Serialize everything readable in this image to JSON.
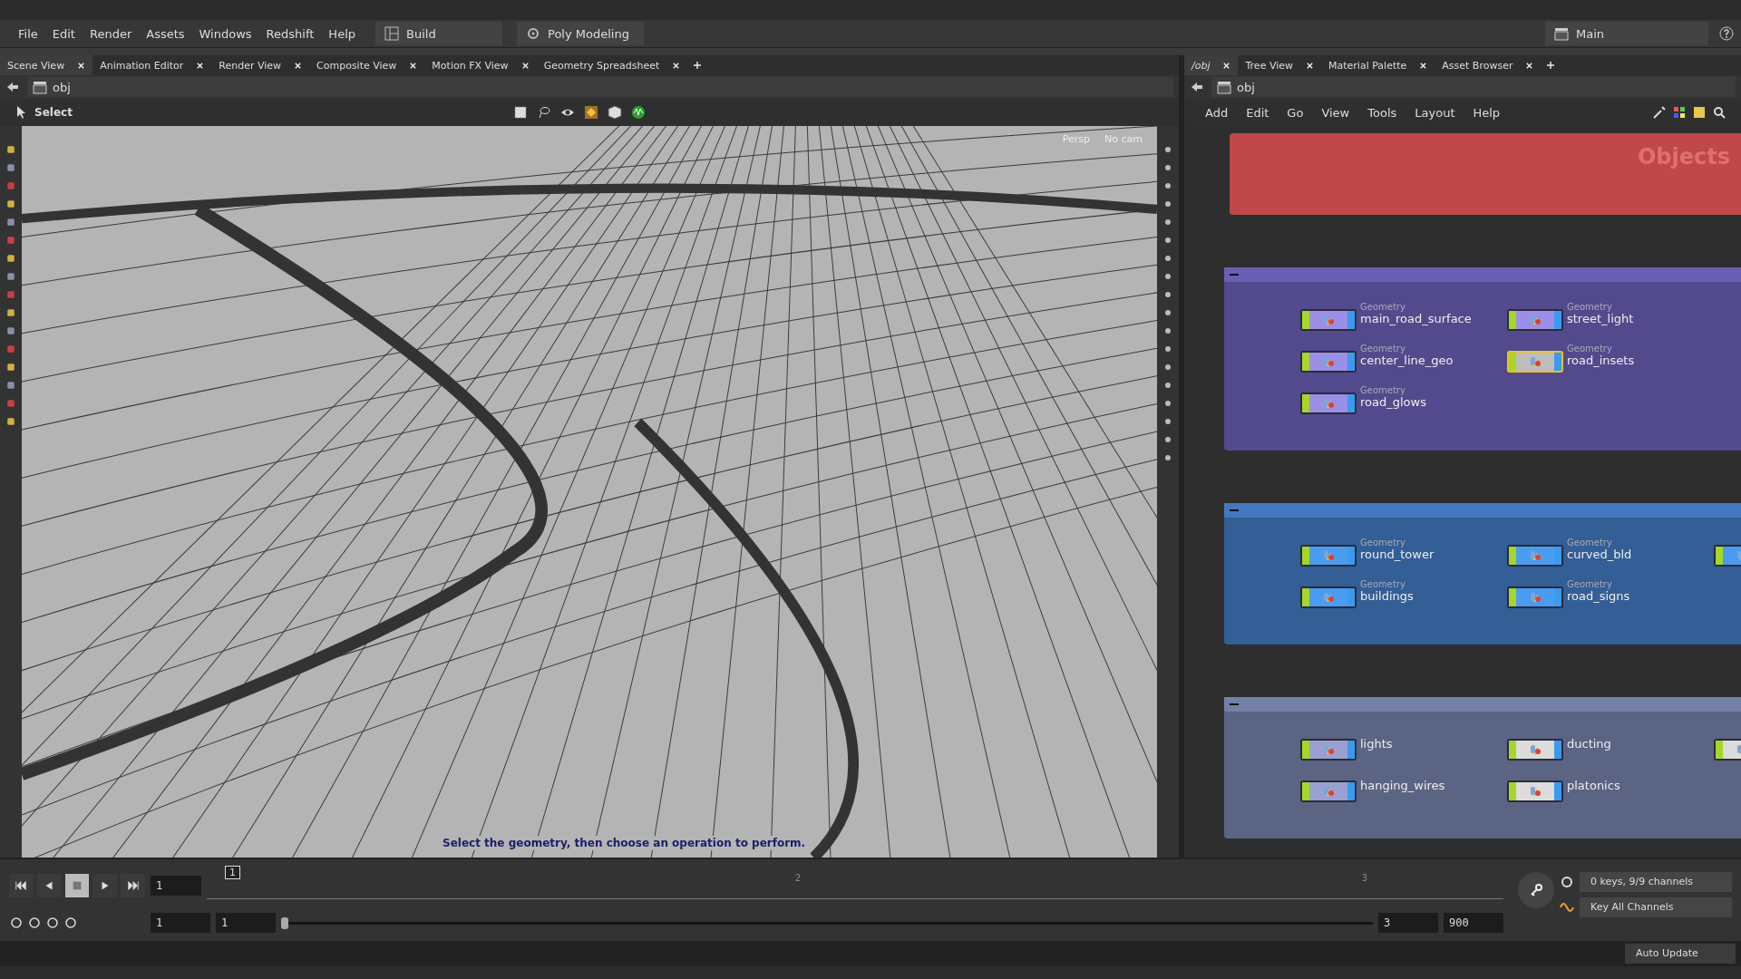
{
  "menu": [
    "File",
    "Edit",
    "Render",
    "Assets",
    "Windows",
    "Redshift",
    "Help"
  ],
  "desktop": {
    "shelf_set": "Build",
    "radial": "Poly Modeling",
    "desktop": "Main"
  },
  "left_pane": {
    "tabs": [
      {
        "label": "Scene View",
        "selected": true
      },
      {
        "label": "Animation Editor",
        "selected": false
      },
      {
        "label": "Render View",
        "selected": false
      },
      {
        "label": "Composite View",
        "selected": false
      },
      {
        "label": "Motion FX View",
        "selected": false
      },
      {
        "label": "Geometry Spreadsheet",
        "selected": false
      }
    ],
    "path": "obj",
    "tool": "Select",
    "view_labels": [
      "Persp",
      "No cam"
    ],
    "prompt": "Select the geometry, then choose an operation to perform."
  },
  "right_pane": {
    "tabs": [
      {
        "label": "/obj",
        "selected": true
      },
      {
        "label": "Tree View",
        "selected": false
      },
      {
        "label": "Material Palette",
        "selected": false
      },
      {
        "label": "Asset Browser",
        "selected": false
      }
    ],
    "path": "obj",
    "menu": [
      "Add",
      "Edit",
      "Go",
      "View",
      "Tools",
      "Layout",
      "Help"
    ],
    "title_box": {
      "title": "Objects",
      "color": "#c04848"
    },
    "boxes": [
      {
        "color": "#6a5fb5",
        "rows": [
          [
            {
              "type": "Geometry",
              "name": "main_road_surface",
              "color": "#9c8fe8",
              "selected": false
            },
            {
              "type": "Geometry",
              "name": "street_light",
              "color": "#9c8fe8",
              "selected": false
            }
          ],
          [
            {
              "type": "Geometry",
              "name": "center_line_geo",
              "color": "#9c8fe8",
              "selected": false
            },
            {
              "type": "Geometry",
              "name": "road_insets",
              "color": "#bdbdbd",
              "selected": true
            }
          ],
          [
            {
              "type": "Geometry",
              "name": "road_glows",
              "color": "#9c8fe8",
              "selected": false
            }
          ]
        ]
      },
      {
        "color": "#4278c0",
        "rows": [
          [
            {
              "type": "Geometry",
              "name": "round_tower",
              "color": "#4a9cf0",
              "selected": false
            },
            {
              "type": "Geometry",
              "name": "curved_bld",
              "color": "#4a9cf0",
              "selected": false
            },
            {
              "color": "#4a9cf0",
              "selected": false
            }
          ],
          [
            {
              "type": "Geometry",
              "name": "buildings",
              "color": "#4a9cf0",
              "selected": false
            },
            {
              "type": "Geometry",
              "name": "road_signs",
              "color": "#4a9cf0",
              "selected": false
            }
          ]
        ]
      },
      {
        "color": "#7580a8",
        "rows": [
          [
            {
              "name": "lights",
              "color": "#9aa0d0",
              "selected": false
            },
            {
              "name": "ducting",
              "color": "#dcdcdc",
              "selected": false
            },
            {
              "color": "#dcdcdc",
              "selected": false
            }
          ],
          [
            {
              "name": "hanging_wires",
              "color": "#9aa0d0",
              "selected": false
            },
            {
              "name": "platonics",
              "color": "#dcdcdc",
              "selected": false
            }
          ]
        ]
      }
    ]
  },
  "timeline": {
    "current_frame": "1",
    "ticks": [
      "2",
      "3"
    ],
    "range_slider": {
      "level": 0
    },
    "frame_field": "1",
    "range": [
      "1",
      "1",
      "3",
      "900"
    ],
    "keys_info": "0 keys, 9/9 channels",
    "key_mode": "Key All Channels",
    "update_mode": "Auto Update"
  }
}
